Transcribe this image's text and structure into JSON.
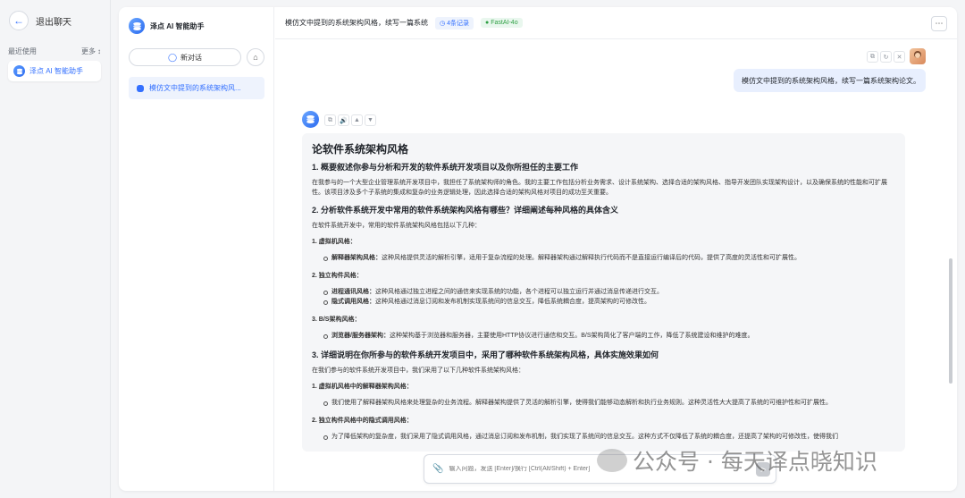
{
  "left_nav": {
    "back_label": "退出聊天",
    "recent_label": "最近使用",
    "more_label": "更多",
    "app_item": "泽点 AI 智能助手"
  },
  "chat_list": {
    "assistant_name": "泽点 AI 智能助手",
    "new_chat": "新对话",
    "item": "模仿文中提到的系统架构风..."
  },
  "topbar": {
    "title": "模仿文中提到的系统架构风格，续写一篇系统",
    "records": "4条记录",
    "model": "FastAI-4o"
  },
  "user_message": "模仿文中提到的系统架构风格，续写一篇系统架构论文。",
  "answer": {
    "title": "论软件系统架构风格",
    "s1_heading": "1. 概要叙述你参与分析和开发的软件系统开发项目以及你所担任的主要工作",
    "s1_para": "在我参与的一个大型企业管理系统开发项目中，我担任了系统架构师的角色。我的主要工作包括分析业务需求、设计系统架构、选择合适的架构风格、指导开发团队实现架构设计，以及确保系统的性能和可扩展性。该项目涉及多个子系统的集成和复杂的业务逻辑处理，因此选择合适的架构风格对项目的成功至关重要。",
    "s2_heading": "2. 分析软件系统开发中常用的软件系统架构风格有哪些？详细阐述每种风格的具体含义",
    "s2_intro": "在软件系统开发中，常用的软件系统架构风格包括以下几种：",
    "s2_g1": "1. 虚拟机风格：",
    "s2_g1_i1_bold": "解释器架构风格：",
    "s2_g1_i1_text": "这种风格提供灵活的解析引擎，适用于复杂流程的处理。解释器架构通过解释执行代码而不是直接运行编译后的代码，提供了高度的灵活性和可扩展性。",
    "s2_g2": "2. 独立构件风格：",
    "s2_g2_i1_bold": "进程通讯风格：",
    "s2_g2_i1_text": "这种风格通过独立进程之间的通信来实现系统的功能，各个进程可以独立运行并通过消息传递进行交互。",
    "s2_g2_i2_bold": "隐式调用风格：",
    "s2_g2_i2_text": "这种风格通过消息订阅和发布机制实现系统间的信息交互，降低系统耦合度，提高架构的可修改性。",
    "s2_g3": "3. B/S架构风格：",
    "s2_g3_i1_bold": "浏览器/服务器架构：",
    "s2_g3_i1_text": "这种架构基于浏览器和服务器，主要使用HTTP协议进行通信和交互。B/S架构简化了客户端的工作，降低了系统建设和维护的难度。",
    "s3_heading": "3. 详细说明在你所参与的软件系统开发项目中，采用了哪种软件系统架构风格，具体实施效果如何",
    "s3_intro": "在我们参与的软件系统开发项目中，我们采用了以下几种软件系统架构风格：",
    "s3_g1": "1. 虚拟机风格中的解释器架构风格：",
    "s3_g1_i1_text": "我们使用了解释器架构风格来处理复杂的业务流程。解释器架构提供了灵活的解析引擎，使得我们能够动态解析和执行业务规则。这种灵活性大大提高了系统的可维护性和可扩展性。",
    "s3_g2": "2. 独立构件风格中的隐式调用风格：",
    "s3_g2_i1_text": "为了降低架构的复杂度，我们采用了隐式调用风格，通过消息订阅和发布机制，我们实现了系统间的信息交互。这种方式不仅降低了系统的耦合度，还提高了架构的可修改性，使得我们"
  },
  "input": {
    "placeholder": "输入问题，发送 [Enter]/换行 [Ctrl(Alt/Shift) + Enter]"
  },
  "watermark": "公众号 · 每天译点晓知识",
  "colors": {
    "accent": "#3370ff",
    "model_tag": "#2ea043"
  }
}
